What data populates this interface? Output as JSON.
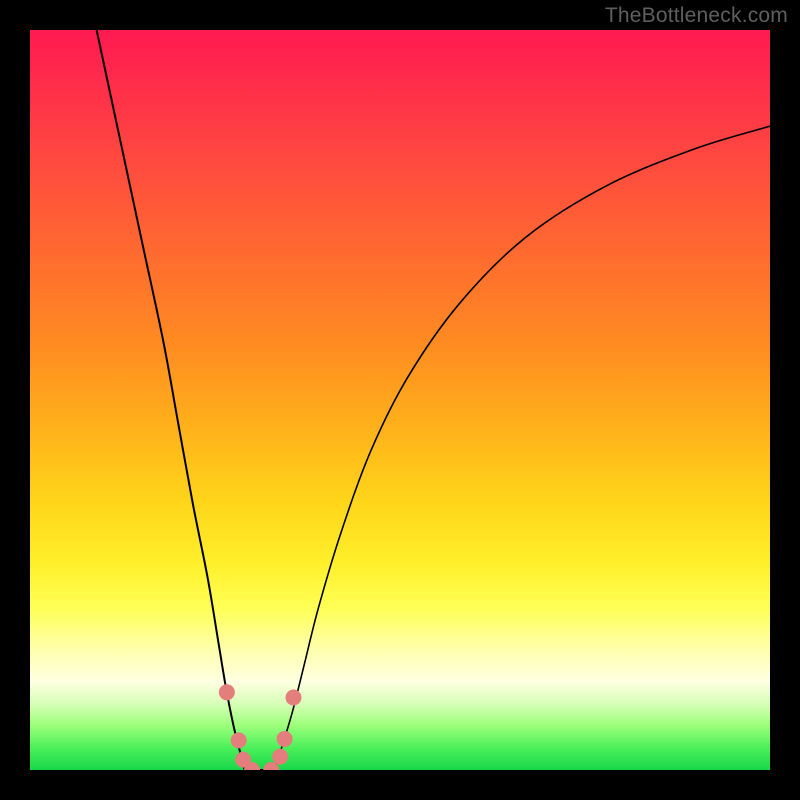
{
  "watermark": "TheBottleneck.com",
  "chart_data": {
    "type": "line",
    "title": "",
    "xlabel": "",
    "ylabel": "",
    "xlim": [
      0,
      100
    ],
    "ylim": [
      0,
      100
    ],
    "grid": false,
    "legend": false,
    "background": {
      "style": "vertical-gradient",
      "stops": [
        {
          "pct": 0,
          "color": "#ff1a50"
        },
        {
          "pct": 30,
          "color": "#ff6a30"
        },
        {
          "pct": 64,
          "color": "#ffd61a"
        },
        {
          "pct": 84,
          "color": "#ffffb0"
        },
        {
          "pct": 100,
          "color": "#18d74a"
        }
      ]
    },
    "series": [
      {
        "name": "left-curve",
        "x": [
          9,
          12,
          15,
          18,
          20,
          22,
          24,
          25.5,
          26.5,
          27.5,
          28.5,
          29
        ],
        "y": [
          100,
          86,
          72,
          58,
          47,
          36,
          26,
          17,
          11,
          6,
          2,
          0
        ]
      },
      {
        "name": "right-curve",
        "x": [
          33,
          34,
          35.5,
          37,
          39,
          42,
          46,
          51,
          58,
          67,
          78,
          90,
          100
        ],
        "y": [
          0,
          3,
          8,
          14,
          22,
          32,
          43,
          53,
          63,
          72,
          79,
          84,
          87
        ]
      }
    ],
    "flat_segment": {
      "x_start": 29,
      "x_end": 33,
      "y": 0
    },
    "points": [
      {
        "name": "p1",
        "x": 26.6,
        "y": 10.5
      },
      {
        "name": "p2",
        "x": 28.2,
        "y": 4.0
      },
      {
        "name": "p3",
        "x": 28.8,
        "y": 1.4
      },
      {
        "name": "p4",
        "x": 30.0,
        "y": 0.0
      },
      {
        "name": "p5",
        "x": 32.6,
        "y": 0.0
      },
      {
        "name": "p6",
        "x": 33.8,
        "y": 1.8
      },
      {
        "name": "p7",
        "x": 34.4,
        "y": 4.2
      },
      {
        "name": "p8",
        "x": 35.6,
        "y": 9.8
      }
    ],
    "colors": {
      "curve": "#000000",
      "points": "#e47e7c",
      "watermark": "#5f5f5f"
    }
  }
}
